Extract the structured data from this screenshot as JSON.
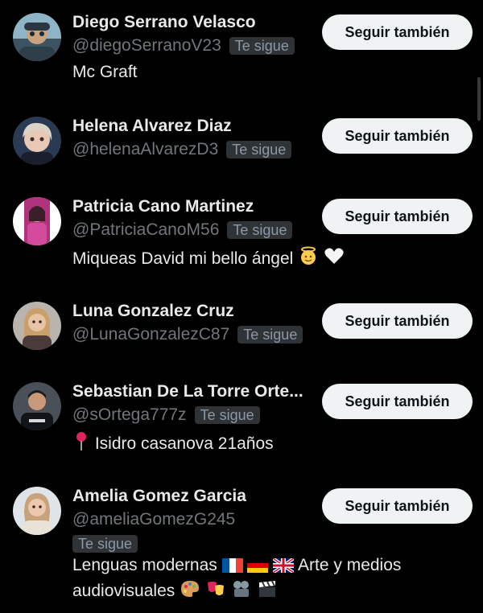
{
  "follow_label": "Seguir también",
  "follows_you_label": "Te sigue",
  "users": [
    {
      "name": "Diego Serrano Velasco",
      "handle": "@diegoSerranoV23",
      "bio": "Mc Graft",
      "avatar_icon": "profile-photo"
    },
    {
      "name": "Helena Alvarez Diaz",
      "handle": "@helenaAlvarezD3",
      "bio": "",
      "avatar_icon": "profile-photo"
    },
    {
      "name": "Patricia Cano Martinez",
      "handle": "@PatriciaCanoM56",
      "bio": "Miqueas David mi bello ángel",
      "avatar_icon": "profile-photo"
    },
    {
      "name": "Luna Gonzalez Cruz",
      "handle": "@LunaGonzalezC87",
      "bio": "",
      "avatar_icon": "profile-photo"
    },
    {
      "name": "Sebastian De La Torre Orte...",
      "handle": "@sOrtega777z",
      "bio": "Isidro casanova 21años",
      "avatar_icon": "profile-photo"
    },
    {
      "name": "Amelia Gomez Garcia",
      "handle": "@ameliaGomezG245",
      "bio_line1": "Lenguas modernas",
      "bio_line1_tail": "Arte y medios",
      "bio_line2": "audiovisuales",
      "avatar_icon": "profile-photo"
    }
  ],
  "colors": {
    "background": "#000000",
    "primary_text": "#e7e9ea",
    "secondary_text": "#71767b",
    "badge_bg": "#2f3336",
    "button_bg": "#eff3f4",
    "button_text": "#0f1419"
  }
}
